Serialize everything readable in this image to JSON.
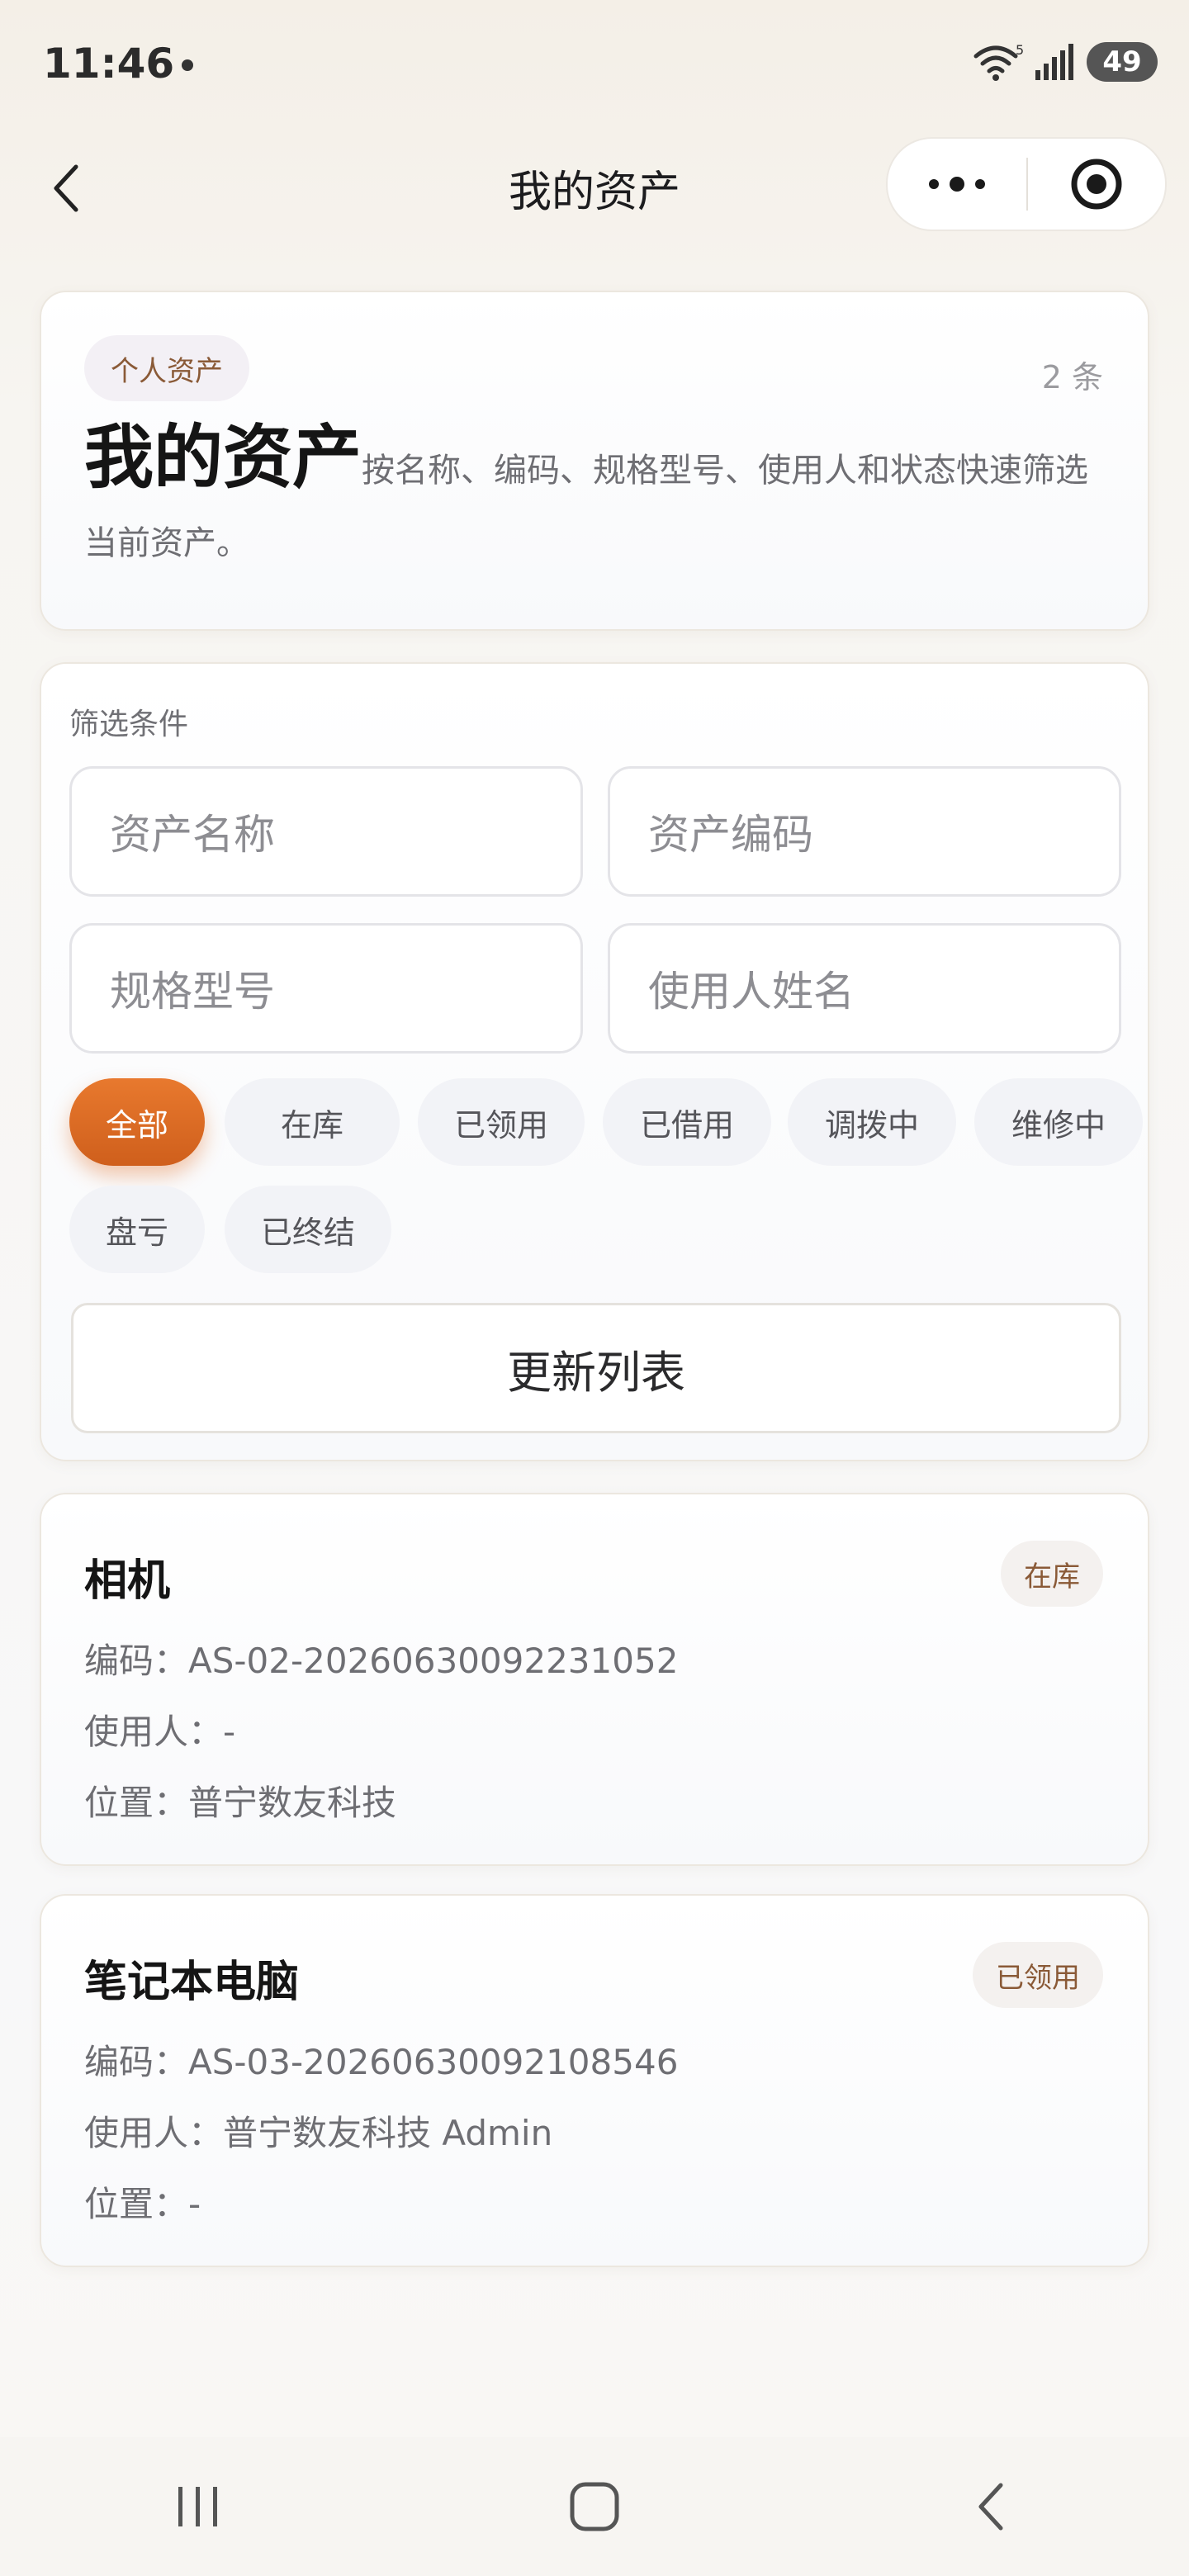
{
  "status_bar": {
    "time": "11:46",
    "battery": "49"
  },
  "nav": {
    "title": "我的资产"
  },
  "hero": {
    "tag": "个人资产",
    "count": "2 条",
    "title": "我的资产",
    "description": "按名称、编码、规格型号、使用人和状态快速筛选当前资产。"
  },
  "filter": {
    "label": "筛选条件",
    "placeholders": {
      "asset_name": "资产名称",
      "asset_code": "资产编码",
      "spec_model": "规格型号",
      "user_name": "使用人姓名"
    },
    "chips": [
      "全部",
      "在库",
      "已领用",
      "已借用",
      "调拨中",
      "维修中",
      "盘亏",
      "已终结"
    ],
    "active_chip": "全部",
    "refresh_label": "更新列表"
  },
  "assets": [
    {
      "name": "相机",
      "status": "在库",
      "code": "编码：AS-02-20260630092231052",
      "user": "使用人：-",
      "location": "位置：普宁数友科技"
    },
    {
      "name": "笔记本电脑",
      "status": "已领用",
      "code": "编码：AS-03-20260630092108546",
      "user": "使用人：普宁数友科技 Admin",
      "location": "位置：-"
    }
  ],
  "colors": {
    "accent": "#e06e28",
    "tag_text": "#8a5a37"
  },
  "icons": [
    "wifi-icon",
    "signal-icon",
    "battery-icon",
    "back-icon",
    "more-icon",
    "target-icon",
    "recents-icon",
    "home-icon",
    "nav-back-icon"
  ]
}
